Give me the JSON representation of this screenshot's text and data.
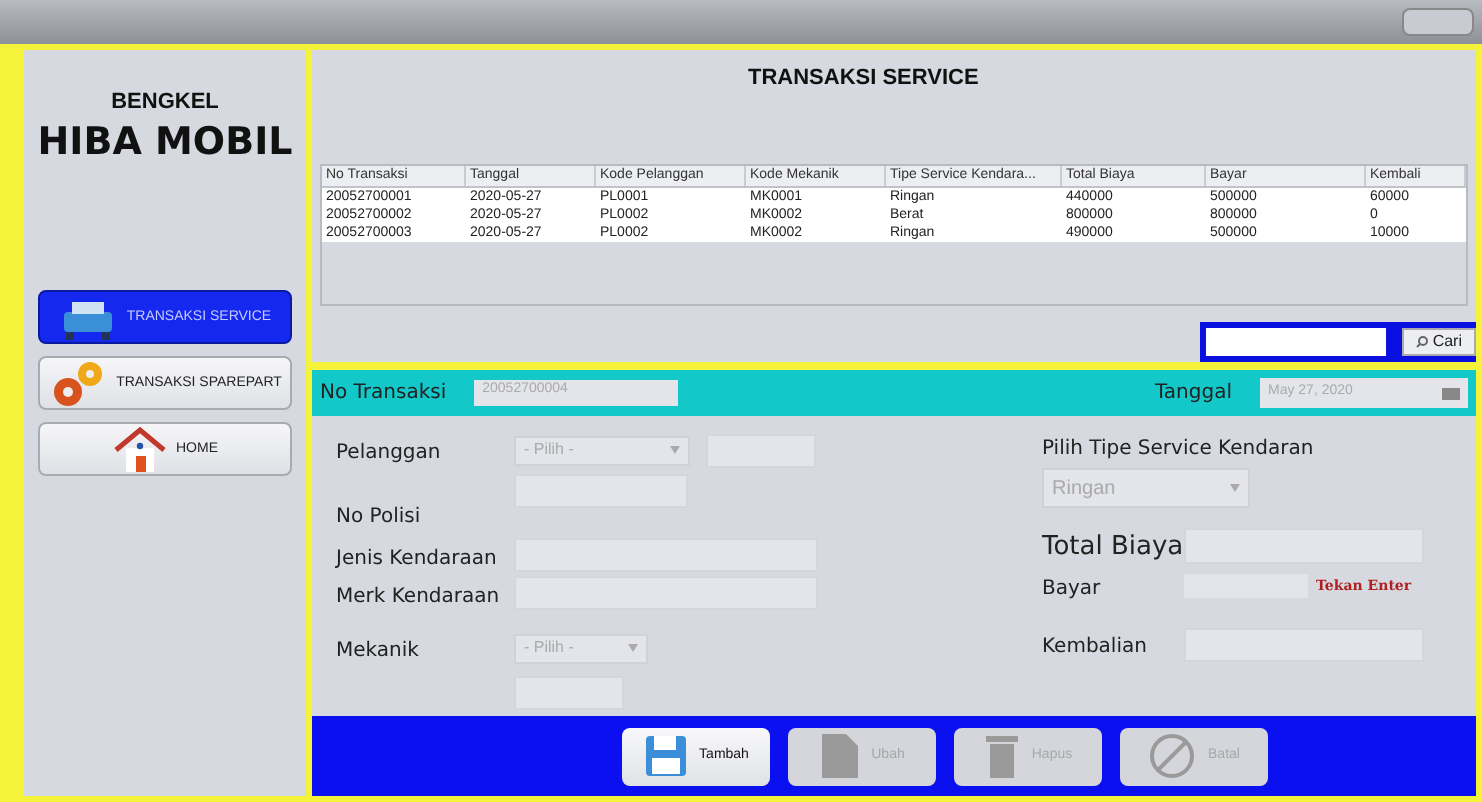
{
  "sidebar": {
    "subtitle": "BENGKEL",
    "title": "HIBA MOBIL",
    "items": [
      {
        "label": "TRANSAKSI SERVICE",
        "kind": "car",
        "selected": true
      },
      {
        "label": "TRANSAKSI SPAREPART",
        "kind": "gears",
        "selected": false
      },
      {
        "label": "HOME",
        "kind": "house",
        "selected": false
      }
    ]
  },
  "page_title": "TRANSAKSI SERVICE",
  "table": {
    "columns": [
      "No Transaksi",
      "Tanggal",
      "Kode Pelanggan",
      "Kode Mekanik",
      "Tipe Service Kendara...",
      "Total Biaya",
      "Bayar",
      "Kembali"
    ],
    "rows": [
      [
        "20052700001",
        "2020-05-27",
        "PL0001",
        "MK0001",
        "Ringan",
        "440000",
        "500000",
        "60000"
      ],
      [
        "20052700002",
        "2020-05-27",
        "PL0002",
        "MK0002",
        "Berat",
        "800000",
        "800000",
        "0"
      ],
      [
        "20052700003",
        "2020-05-27",
        "PL0002",
        "MK0002",
        "Ringan",
        "490000",
        "500000",
        "10000"
      ]
    ]
  },
  "search": {
    "button": "Cari"
  },
  "form": {
    "no_transaksi_label": "No Transaksi",
    "no_transaksi_value": "20052700004",
    "tanggal_label": "Tanggal",
    "tanggal_value": "May 27, 2020",
    "pelanggan_label": "Pelanggan",
    "pelanggan_select": "- Pilih -",
    "no_polisi_label": "No Polisi",
    "jenis_label": "Jenis Kendaraan",
    "merk_label": "Merk Kendaraan",
    "mekanik_label": "Mekanik",
    "mekanik_select": "- Pilih -",
    "tipe_label": "Pilih Tipe Service Kendaran",
    "tipe_select": "Ringan",
    "total_label": "Total Biaya",
    "bayar_label": "Bayar",
    "bayar_hint": "Tekan Enter",
    "kembalian_label": "Kembalian"
  },
  "buttons": [
    {
      "label": "Tambah",
      "kind": "save",
      "disabled": false
    },
    {
      "label": "Ubah",
      "kind": "edit",
      "disabled": true
    },
    {
      "label": "Hapus",
      "kind": "trash",
      "disabled": true
    },
    {
      "label": "Batal",
      "kind": "cancel",
      "disabled": true
    }
  ]
}
